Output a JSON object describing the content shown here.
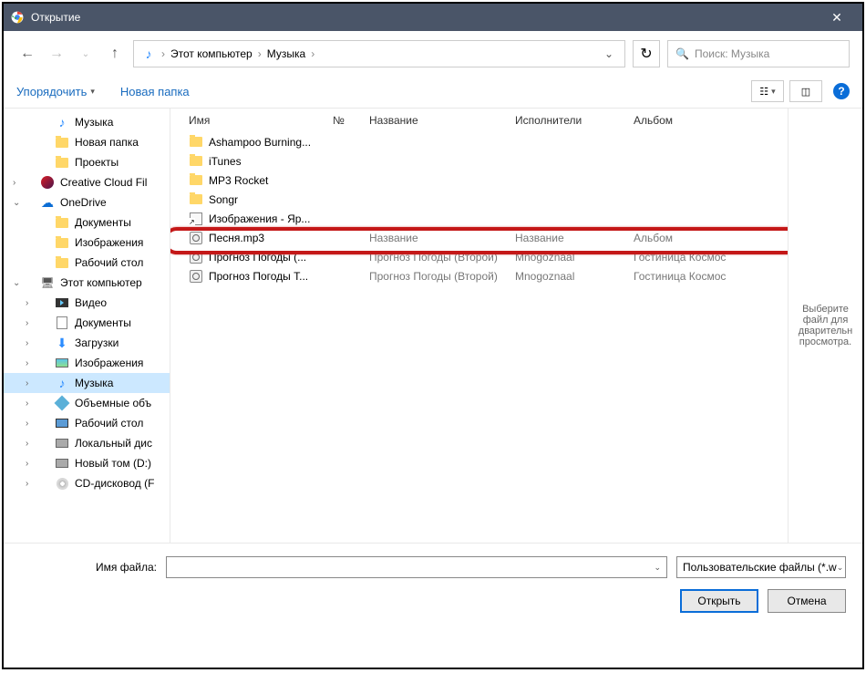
{
  "titlebar": {
    "title": "Открытие",
    "close": "✕"
  },
  "nav": {
    "breadcrumb": [
      "Этот компьютер",
      "Музыка"
    ],
    "search_placeholder": "Поиск: Музыка"
  },
  "toolbar": {
    "organize": "Упорядочить",
    "new_folder": "Новая папка"
  },
  "tree": [
    {
      "lvl": 2,
      "icon": "music",
      "label": "Музыка"
    },
    {
      "lvl": 2,
      "icon": "folder",
      "label": "Новая папка"
    },
    {
      "lvl": 2,
      "icon": "folder",
      "label": "Проекты"
    },
    {
      "lvl": 1,
      "icon": "cc",
      "label": "Creative Cloud Fil",
      "exp": ">"
    },
    {
      "lvl": 1,
      "icon": "onedrive",
      "label": "OneDrive",
      "exp": "v"
    },
    {
      "lvl": 2,
      "icon": "folder",
      "label": "Документы"
    },
    {
      "lvl": 2,
      "icon": "folder",
      "label": "Изображения"
    },
    {
      "lvl": 2,
      "icon": "folder",
      "label": "Рабочий стол"
    },
    {
      "lvl": 1,
      "icon": "pc",
      "label": "Этот компьютер",
      "exp": "v"
    },
    {
      "lvl": 2,
      "icon": "video",
      "label": "Видео",
      "exp": ">"
    },
    {
      "lvl": 2,
      "icon": "doc",
      "label": "Документы",
      "exp": ">"
    },
    {
      "lvl": 2,
      "icon": "dl",
      "label": "Загрузки",
      "exp": ">"
    },
    {
      "lvl": 2,
      "icon": "img",
      "label": "Изображения",
      "exp": ">"
    },
    {
      "lvl": 2,
      "icon": "music",
      "label": "Музыка",
      "exp": ">",
      "selected": true
    },
    {
      "lvl": 2,
      "icon": "3d",
      "label": "Объемные объ",
      "exp": ">"
    },
    {
      "lvl": 2,
      "icon": "desk",
      "label": "Рабочий стол",
      "exp": ">"
    },
    {
      "lvl": 2,
      "icon": "drive",
      "label": "Локальный дис",
      "exp": ">"
    },
    {
      "lvl": 2,
      "icon": "drive",
      "label": "Новый том (D:)",
      "exp": ">"
    },
    {
      "lvl": 2,
      "icon": "cd",
      "label": "CD-дисковод (F",
      "exp": ">"
    }
  ],
  "columns": {
    "name": "Имя",
    "num": "№",
    "title": "Название",
    "artist": "Исполнители",
    "album": "Альбом"
  },
  "files": [
    {
      "icon": "folder",
      "name": "Ashampoo Burning..."
    },
    {
      "icon": "folder",
      "name": "iTunes"
    },
    {
      "icon": "folder",
      "name": "MP3 Rocket"
    },
    {
      "icon": "folder",
      "name": "Songr"
    },
    {
      "icon": "shortcut",
      "name": "Изображения - Яр..."
    },
    {
      "icon": "mp3",
      "name": "Песня.mp3",
      "title": "Название",
      "artist": "Название",
      "album": "Альбом",
      "highlighted": true
    },
    {
      "icon": "mp3",
      "name": "Прогноз Погоды (...",
      "title": "Прогноз Погоды (Второй)",
      "artist": "Mnogoznaal",
      "album": "Гостиница Космос"
    },
    {
      "icon": "mp3",
      "name": "Прогноз Погоды Т...",
      "title": "Прогноз Погоды (Второй)",
      "artist": "Mnogoznaal",
      "album": "Гостиница Космос"
    }
  ],
  "preview": "Выберите файл для дварительн просмотра.",
  "bottom": {
    "filename_label": "Имя файла:",
    "filter": "Пользовательские файлы (*.w",
    "open": "Открыть",
    "cancel": "Отмена"
  }
}
